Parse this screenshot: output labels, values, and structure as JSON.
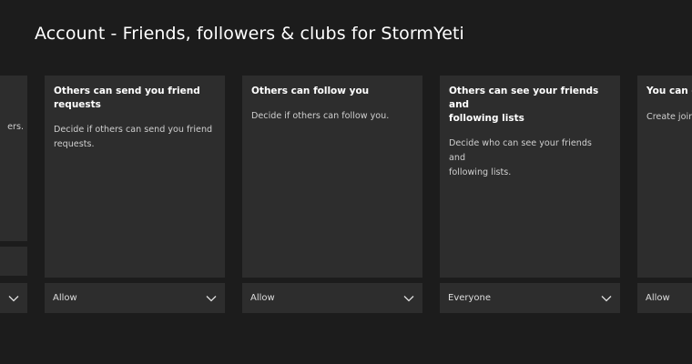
{
  "page": {
    "title": "Account - Friends, followers & clubs for StormYeti"
  },
  "left_card": {
    "desc_fragment": "ers."
  },
  "cards": [
    {
      "title": "Others can send you friend requests",
      "description": "Decide if others can send you friend\nrequests.",
      "value": "Allow"
    },
    {
      "title": "Others can follow you",
      "description": "Decide if others can follow you.",
      "value": "Allow"
    },
    {
      "title": "Others can see your friends and\nfollowing lists",
      "description": "Decide who can see your friends and\nfollowing lists.",
      "value": "Everyone"
    },
    {
      "title": "You can cre",
      "description": "Create join, cl",
      "value": "Allow"
    }
  ]
}
